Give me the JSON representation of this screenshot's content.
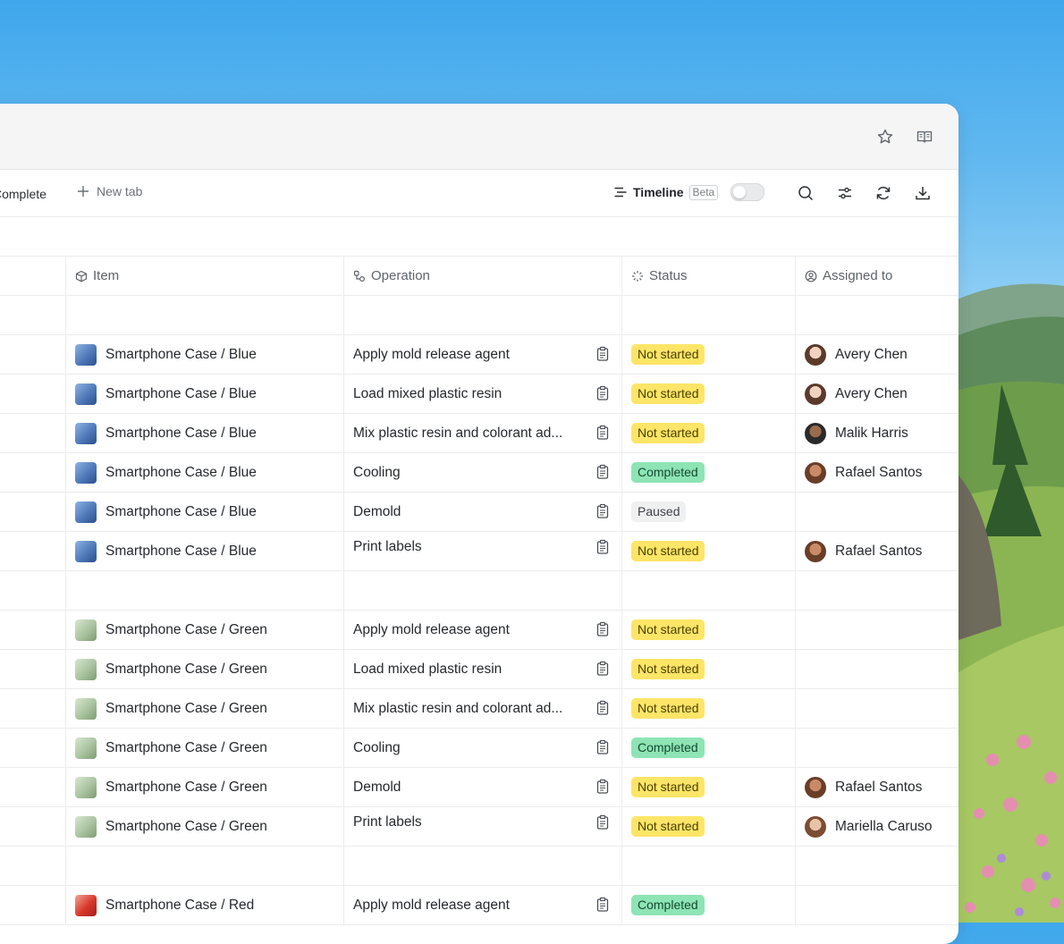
{
  "toolbar": {
    "complete_tab": "Complete",
    "new_tab": "New tab",
    "timeline": "Timeline",
    "beta": "Beta"
  },
  "columns": {
    "item": "Item",
    "operation": "Operation",
    "status": "Status",
    "assigned": "Assigned to"
  },
  "rows": [
    {
      "item": "Smartphone Case / Blue",
      "operation": "Apply mold release agent",
      "status": "Not started",
      "assigned": "Avery Chen"
    },
    {
      "item": "Smartphone Case / Blue",
      "operation": "Load mixed plastic resin",
      "status": "Not started",
      "assigned": "Avery Chen"
    },
    {
      "item": "Smartphone Case / Blue",
      "operation": "Mix plastic resin and colorant ad...",
      "status": "Not started",
      "assigned": "Malik Harris"
    },
    {
      "item": "Smartphone Case / Blue",
      "operation": "Cooling",
      "status": "Completed",
      "assigned": "Rafael Santos"
    },
    {
      "item": "Smartphone Case / Blue",
      "operation": "Demold",
      "status": "Paused",
      "assigned": ""
    },
    {
      "item": "Smartphone Case / Blue",
      "operation": "Print labels",
      "status": "Not started",
      "assigned": "Rafael Santos"
    },
    {
      "item": "Smartphone Case / Green",
      "operation": "Apply mold release agent",
      "status": "Not started",
      "assigned": ""
    },
    {
      "item": "Smartphone Case / Green",
      "operation": "Load mixed plastic resin",
      "status": "Not started",
      "assigned": ""
    },
    {
      "item": "Smartphone Case / Green",
      "operation": "Mix plastic resin and colorant ad...",
      "status": "Not started",
      "assigned": ""
    },
    {
      "item": "Smartphone Case / Green",
      "operation": "Cooling",
      "status": "Completed",
      "assigned": ""
    },
    {
      "item": "Smartphone Case / Green",
      "operation": "Demold",
      "status": "Not started",
      "assigned": "Rafael Santos"
    },
    {
      "item": "Smartphone Case / Green",
      "operation": "Print labels",
      "status": "Not started",
      "assigned": "Mariella Caruso"
    },
    {
      "item": "Smartphone Case / Red",
      "operation": "Apply mold release agent",
      "status": "Completed",
      "assigned": ""
    }
  ],
  "colors": {
    "not_started": "#fde567",
    "completed": "#8ee4b5",
    "paused": "#f0f0f1"
  }
}
